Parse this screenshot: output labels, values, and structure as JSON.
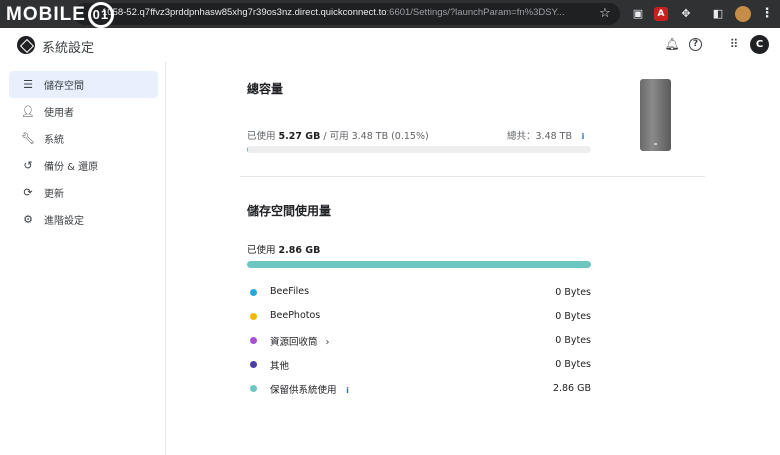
{
  "browser": {
    "url_visible": "10",
    "url_rest": "58-52.q7ffvz3prddpnhasw85xhg7r39os3nz.direct.quickconnect.to",
    "url_dim": ":6601/Settings/?launchParam=fn%3DSY..."
  },
  "watermark": {
    "text": "MOBILE",
    "badge": "01"
  },
  "app": {
    "title": "系統設定",
    "avatar_letter": "C"
  },
  "sidebar": {
    "items": [
      {
        "label": "儲存空間",
        "icon": "storage-icon",
        "active": true
      },
      {
        "label": "使用者",
        "icon": "user-icon",
        "active": false
      },
      {
        "label": "系統",
        "icon": "wrench-icon",
        "active": false
      },
      {
        "label": "備份 & 還原",
        "icon": "backup-restore-icon",
        "active": false
      },
      {
        "label": "更新",
        "icon": "refresh-icon",
        "active": false
      },
      {
        "label": "進階設定",
        "icon": "advanced-settings-icon",
        "active": false
      }
    ]
  },
  "capacity": {
    "heading": "總容量",
    "used_prefix": "已使用 ",
    "used_value": "5.27 GB",
    "available_text": " / 可用 3.48 TB (0.15%)",
    "total_text": "總共：3.48 TB",
    "used_fraction": 0.0015
  },
  "usage": {
    "heading": "儲存空間使用量",
    "used_prefix": "已使用 ",
    "used_value": "2.86 GB",
    "used_fraction": 1.0,
    "items": [
      {
        "label": "BeeFiles",
        "value": "0 Bytes",
        "color": "#2aa7d6"
      },
      {
        "label": "BeePhotos",
        "value": "0 Bytes",
        "color": "#f2b705"
      },
      {
        "label": "資源回收筒",
        "value": "0 Bytes",
        "color": "#a64fd6"
      },
      {
        "label": "其他",
        "value": "0 Bytes",
        "color": "#4b3fa3"
      },
      {
        "label": "保留供系統使用",
        "value": "2.86 GB",
        "color": "#6ec6c0"
      }
    ]
  },
  "colors": {
    "accent": "#4fbcb5",
    "active_bg": "#e8f0fe"
  }
}
